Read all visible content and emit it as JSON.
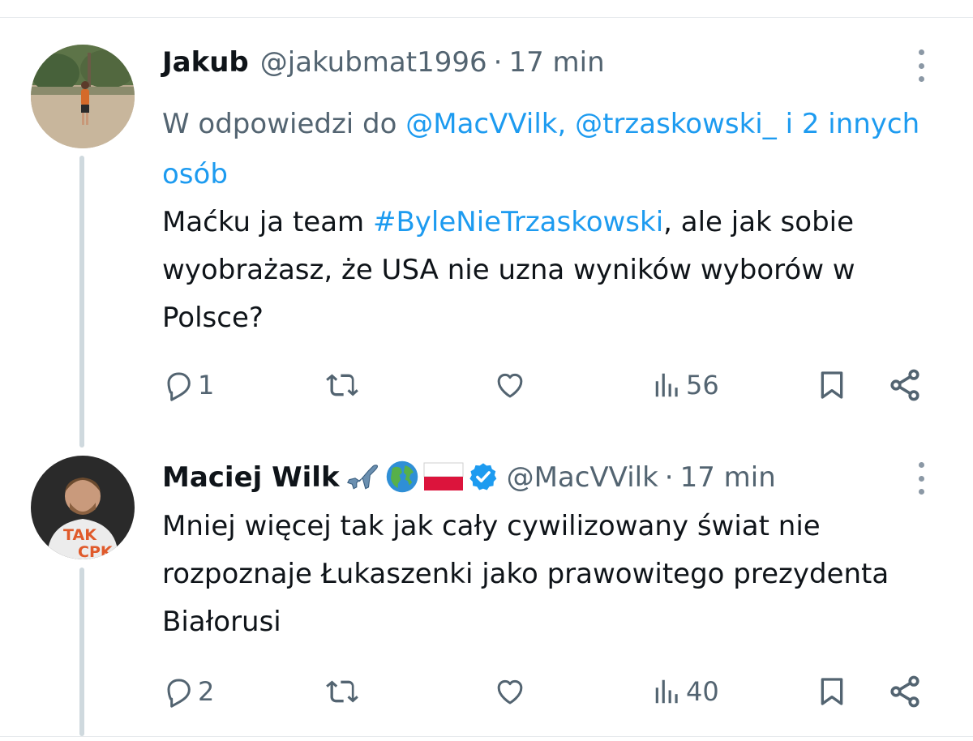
{
  "tweets": [
    {
      "name": "Jakub",
      "handle": "@jakubmat1996",
      "time": "17 min",
      "reply_prefix": "W odpowiedzi do ",
      "reply_handle_1": "@MacVVilk,",
      "reply_handle_2": "@trzaskowski_",
      "reply_others": "i 2 innych osób",
      "text_before": "Maćku ja team ",
      "hashtag": "#ByleNieTrzaskowski",
      "text_after": ", ale jak sobie wyobrażasz, że USA nie uzna wyników wyborów w Polsce?",
      "replies": "1",
      "views": "56"
    },
    {
      "name": "Maciej Wilk",
      "emoji": [
        "airplane",
        "globe-americas",
        "poland-flag"
      ],
      "handle": "@MacVVilk",
      "time": "17 min",
      "text": "Mniej więcej tak jak cały cywilizowany świat nie rozpoznaje Łukaszenki jako prawowitego prezydenta Białorusi",
      "avatar_text_1": "TAK",
      "avatar_text_2": "CPK",
      "replies": "2",
      "views": "40"
    }
  ],
  "dot_separator": "·",
  "colors": {
    "text": "#0f1419",
    "secondary": "#536471",
    "link": "#1d9bf0",
    "thread_line": "#cfd9de",
    "verified": "#1d9bf0"
  }
}
